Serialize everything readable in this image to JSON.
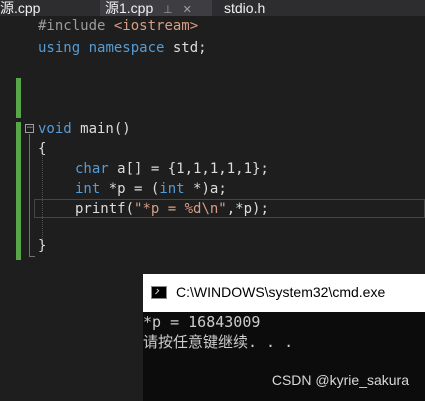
{
  "tabs": [
    {
      "label": "源.cpp"
    },
    {
      "label": "源1.cpp",
      "pin": "⊥",
      "close": "✕"
    },
    {
      "label": "stdio.h"
    }
  ],
  "code": {
    "line1": {
      "pp": "#include",
      "inc": "<iostream>"
    },
    "line2": {
      "kw1": "using",
      "kw2": "namespace",
      "rest": " std;"
    },
    "line5": {
      "kw": "void",
      "rest": " main()"
    },
    "line6": {
      "text": "{"
    },
    "line7": {
      "kw": "char",
      "rest": " a[] = {1,1,1,1,1};"
    },
    "line8": {
      "kw1": "int",
      "mid": " *p = (",
      "kw2": "int",
      "rest": " *)a;"
    },
    "line9": {
      "fn": "printf(",
      "str": "\"*p = %d\\n\"",
      "rest": ",*p);"
    },
    "line11": {
      "text": "}"
    }
  },
  "fold_toggle": "−",
  "console": {
    "title": "C:\\WINDOWS\\system32\\cmd.exe",
    "output_line1": "*p = 16843009",
    "output_line2": "请按任意键继续. . ."
  },
  "watermark": "CSDN @kyrie_sakura",
  "colors": {
    "keyword": "#569cd6",
    "string": "#d69d85",
    "preprocessor": "#9b9b9b",
    "change_bar": "#57a64a",
    "editor_bg": "#1e1e1e"
  }
}
